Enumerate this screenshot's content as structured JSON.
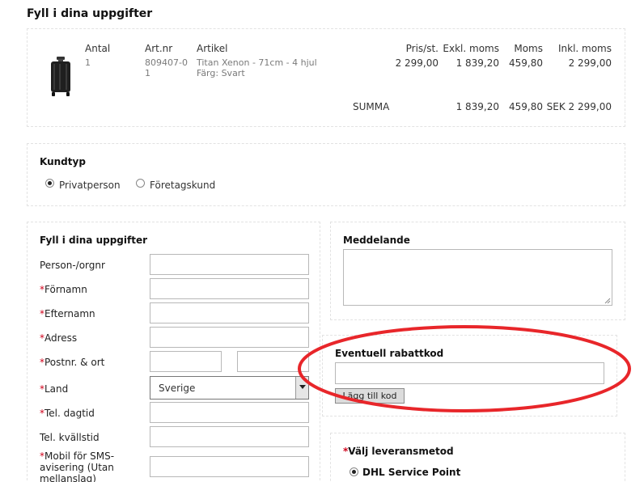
{
  "page": {
    "title": "Fyll i dina uppgifter"
  },
  "cart": {
    "headers": {
      "qty": "Antal",
      "artnr": "Art.nr",
      "article": "Artikel",
      "price": "Pris/st.",
      "excl": "Exkl. moms",
      "vat": "Moms",
      "incl": "Inkl. moms"
    },
    "row": {
      "qty": "1",
      "artnr": "809407-01",
      "article_name": "Titan Xenon - 71cm - 4 hjul",
      "article_color": "Färg: Svart",
      "price": "2 299,00",
      "excl": "1 839,20",
      "vat": "459,80",
      "incl": "2 299,00"
    },
    "summary": {
      "label": "SUMMA",
      "excl": "1 839,20",
      "vat": "459,80",
      "incl": "SEK 2 299,00"
    }
  },
  "customer_type": {
    "title": "Kundtyp",
    "options": [
      "Privatperson",
      "Företagskund"
    ],
    "selected": "Privatperson"
  },
  "form": {
    "title": "Fyll i dina uppgifter",
    "required_mark": "*",
    "fields": {
      "person": "Person-/orgnr",
      "firstname": "Förnamn",
      "lastname": "Efternamn",
      "address": "Adress",
      "postal": "Postnr. & ort",
      "country": "Land",
      "country_value": "Sverige",
      "phone_day": "Tel. dagtid",
      "phone_evening": "Tel. kvällstid",
      "mobile_line1": "Mobil för SMS-",
      "mobile_line2": "avisering (Utan",
      "mobile_line3": "mellanslag)"
    }
  },
  "message": {
    "title": "Meddelande"
  },
  "discount": {
    "title": "Eventuell rabattkod",
    "button": "Lägg till kod"
  },
  "delivery": {
    "title": "Välj leveransmetod",
    "options": [
      "DHL Service Point"
    ],
    "selected": "DHL Service Point"
  },
  "colors": {
    "annotation": "#e8262a",
    "required": "#d0021b"
  }
}
